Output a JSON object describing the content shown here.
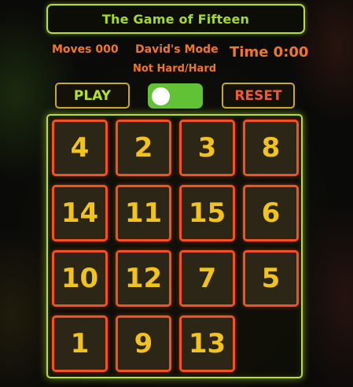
{
  "header": {
    "title": "The Game of Fifteen"
  },
  "stats": {
    "moves": "Moves 000",
    "mode": "David's Mode",
    "mode_sub": "Not Hard/Hard",
    "time": "Time 0:00"
  },
  "controls": {
    "play_label": "PLAY",
    "reset_label": "RESET",
    "toggle_on": true
  },
  "board": {
    "rows": [
      [
        "4",
        "2",
        "3",
        "8"
      ],
      [
        "14",
        "11",
        "15",
        "6"
      ],
      [
        "10",
        "12",
        "7",
        "5"
      ],
      [
        "1",
        "9",
        "13",
        ""
      ]
    ]
  },
  "colors": {
    "accent_green": "#b6e02b",
    "accent_orange": "#f0762a",
    "tile_border": "#f2521f",
    "tile_number": "#f2c21d",
    "toggle_bg": "#61c236"
  }
}
